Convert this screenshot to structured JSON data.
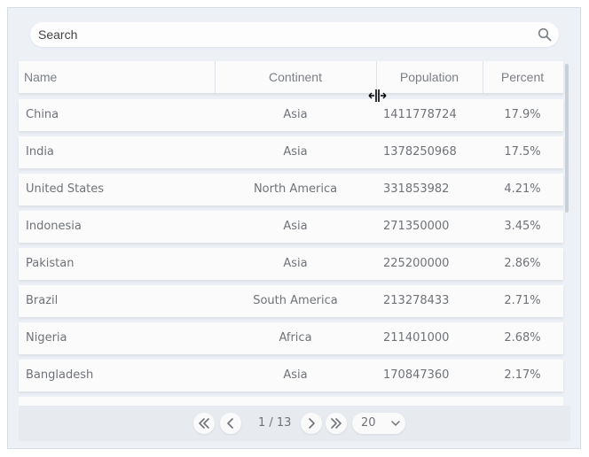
{
  "search": {
    "placeholder": "Search"
  },
  "columns": [
    "Name",
    "Continent",
    "Population",
    "Percent"
  ],
  "rows": [
    {
      "name": "China",
      "continent": "Asia",
      "population": "1411778724",
      "percent": "17.9%"
    },
    {
      "name": "India",
      "continent": "Asia",
      "population": "1378250968",
      "percent": "17.5%"
    },
    {
      "name": "United States",
      "continent": "North America",
      "population": "331853982",
      "percent": "4.21%"
    },
    {
      "name": "Indonesia",
      "continent": "Asia",
      "population": "271350000",
      "percent": "3.45%"
    },
    {
      "name": "Pakistan",
      "continent": "Asia",
      "population": "225200000",
      "percent": "2.86%"
    },
    {
      "name": "Brazil",
      "continent": "South America",
      "population": "213278433",
      "percent": "2.71%"
    },
    {
      "name": "Nigeria",
      "continent": "Africa",
      "population": "211401000",
      "percent": "2.68%"
    },
    {
      "name": "Bangladesh",
      "continent": "Asia",
      "population": "170847360",
      "percent": "2.17%"
    }
  ],
  "pagination": {
    "page_info": "1 / 13",
    "page_size": "20",
    "icons": [
      "first-page-icon",
      "prev-page-icon",
      "next-page-icon",
      "last-page-icon"
    ]
  },
  "colors": {
    "background": "#edf1f6",
    "row": "#fbfbfb",
    "text": "#6f7378"
  }
}
